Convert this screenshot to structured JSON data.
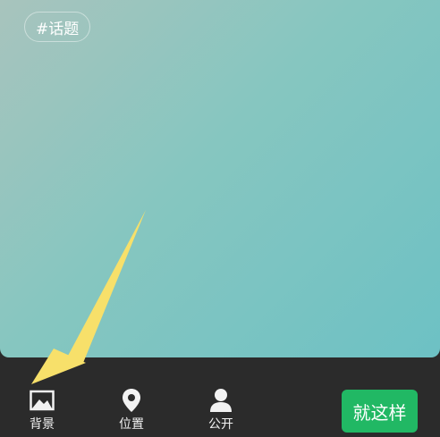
{
  "canvas": {
    "topic_chip": "#话题"
  },
  "toolbar": {
    "items": [
      {
        "label": "背景",
        "icon": "image-icon"
      },
      {
        "label": "位置",
        "icon": "location-pin-icon"
      },
      {
        "label": "公开",
        "icon": "person-icon"
      }
    ],
    "submit_label": "就这样"
  },
  "colors": {
    "canvas_gradient_start": "#a8c4bd",
    "canvas_gradient_end": "#6dc1c4",
    "toolbar_bg": "#2b2b2b",
    "submit_bg": "#21b864",
    "annotation_arrow": "#f7e06a"
  }
}
